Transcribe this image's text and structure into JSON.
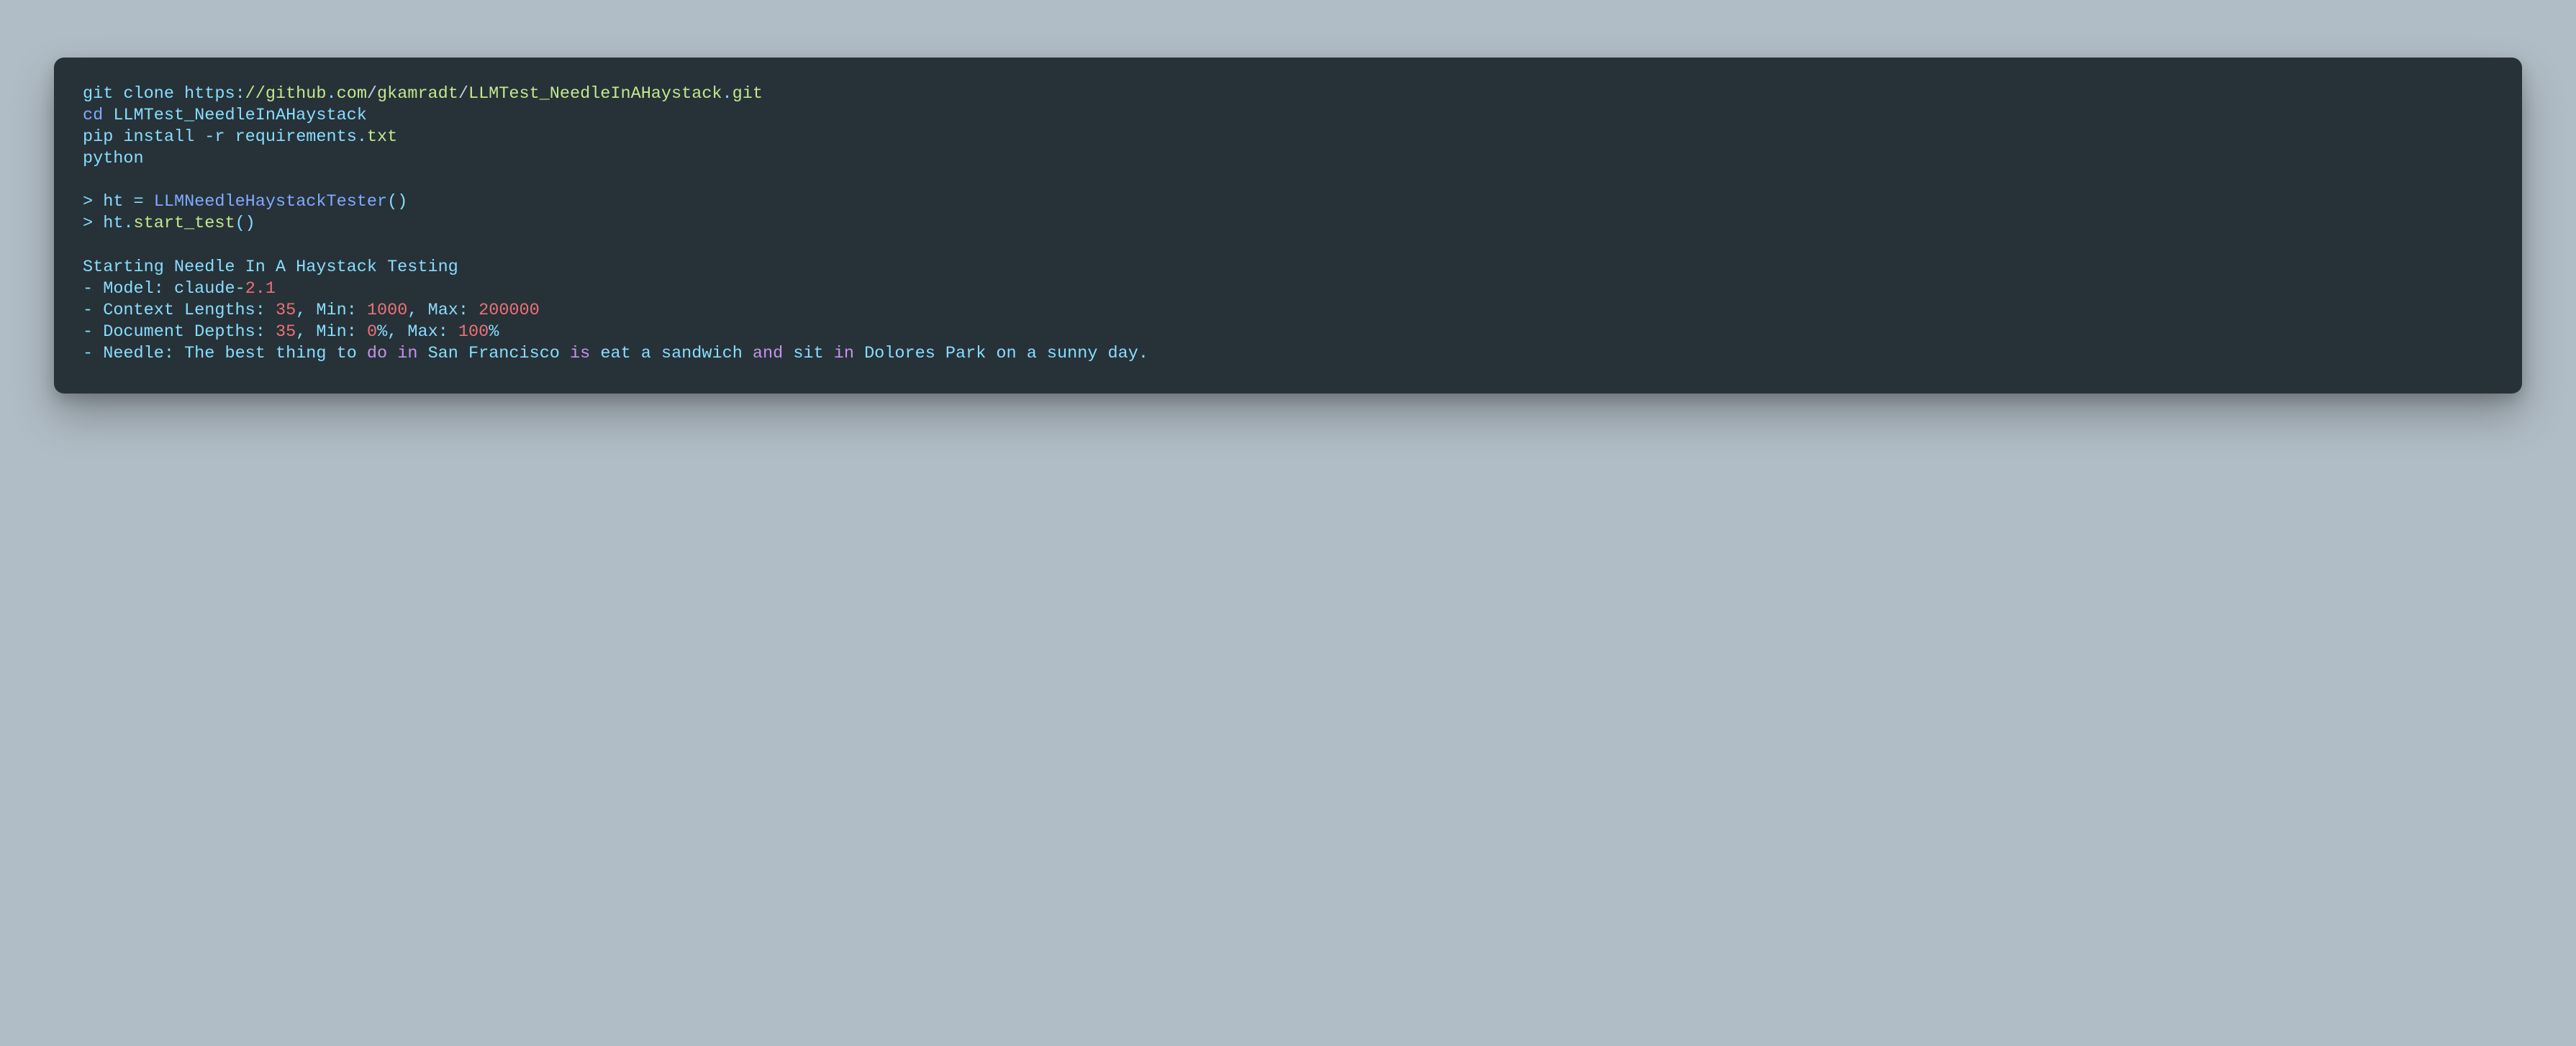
{
  "code": {
    "l1_git": "git",
    "l1_clone": "clone",
    "l1_https": "https",
    "l1_colon": ":",
    "l1_slashes": "//github",
    "l1_dot1": ".",
    "l1_com": "com",
    "l1_s1": "/",
    "l1_gk": "gkamradt",
    "l1_s2": "/",
    "l1_repo": "LLMTest_NeedleInAHaystack",
    "l1_dot2": ".",
    "l1_gitext": "git",
    "l2_cd": "cd",
    "l2_dir": "LLMTest_NeedleInAHaystack",
    "l3_pip": "pip",
    "l3_install": "install",
    "l3_dash": "-",
    "l3_r": "r",
    "l3_req": "requirements",
    "l3_dot": ".",
    "l3_txt": "txt",
    "l4_python": "python",
    "l6_gt": ">",
    "l6_ht": "ht",
    "l6_eq": "=",
    "l6_ctor": "LLMNeedleHaystackTester",
    "l6_paren": "()",
    "l7_gt": ">",
    "l7_ht": "ht",
    "l7_dot": ".",
    "l7_method": "start_test",
    "l7_paren": "()",
    "l9_start": "Starting Needle In A Haystack Testing",
    "l10_dash": "-",
    "l10_model": "Model",
    "l10_colon": ":",
    "l10_claude": "claude",
    "l10_dash2": "-",
    "l10_ver": "2.1",
    "l11_dash": "-",
    "l11_ctx": "Context Lengths",
    "l11_colon": ":",
    "l11_35": "35",
    "l11_comma1": ",",
    "l11_min": "Min",
    "l11_colon2": ":",
    "l11_1000": "1000",
    "l11_comma2": ",",
    "l11_max": "Max",
    "l11_colon3": ":",
    "l11_200k": "200000",
    "l12_dash": "-",
    "l12_dd": "Document Depths",
    "l12_colon": ":",
    "l12_35": "35",
    "l12_comma1": ",",
    "l12_min": "Min",
    "l12_colon2": ":",
    "l12_0": "0",
    "l12_pct1": "%",
    "l12_comma2": ",",
    "l12_max": "Max",
    "l12_colon3": ":",
    "l12_100": "100",
    "l12_pct2": "%",
    "l13_dash": "-",
    "l13_needle": "Needle",
    "l13_colon": ":",
    "l13_the_best": "The best thing to",
    "l13_do": "do",
    "l13_in1": "in",
    "l13_sf": "San Francisco",
    "l13_is": "is",
    "l13_eat": "eat a sandwich",
    "l13_and": "and",
    "l13_sit": "sit",
    "l13_in2": "in",
    "l13_dolores": "Dolores Park on a sunny day",
    "l13_period": "."
  }
}
